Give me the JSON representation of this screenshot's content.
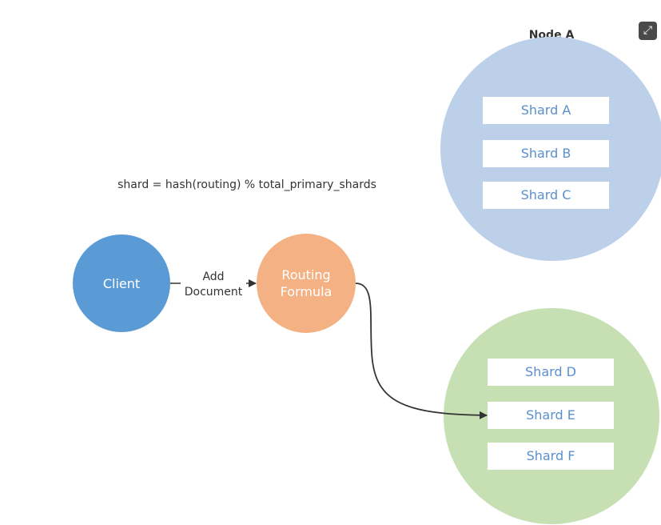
{
  "formula": "shard = hash(routing) % total_primary_shards",
  "nodes": {
    "node_a": {
      "label": "Node A",
      "shards": [
        "Shard A",
        "Shard B",
        "Shard C"
      ],
      "color": "#bdd0e9"
    },
    "node_b": {
      "shards": [
        "Shard D",
        "Shard E",
        "Shard F"
      ],
      "color": "#c6e0b4"
    }
  },
  "client": {
    "label": "Client",
    "color": "#5b9bd5"
  },
  "routing": {
    "label_line1": "Routing",
    "label_line2": "Formula",
    "color": "#f4b183"
  },
  "edge_label": {
    "line1": "Add",
    "line2": "Document"
  },
  "shard_text_color": "#5b8fce",
  "fullscreen_icon": "expand-icon"
}
